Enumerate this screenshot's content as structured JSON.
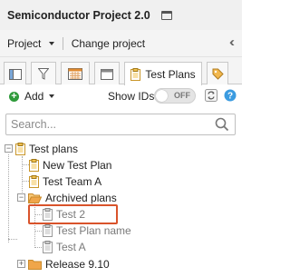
{
  "header": {
    "title": "Semiconductor Project 2.0",
    "window_icon": "window-icon"
  },
  "project_bar": {
    "project_label": "Project",
    "change_label": "Change project",
    "collapse_icon": "double-chevron-left-icon"
  },
  "tabs": [
    {
      "icon": "tree-view-icon",
      "label": ""
    },
    {
      "icon": "filter-icon",
      "label": ""
    },
    {
      "icon": "calendar-icon",
      "label": ""
    },
    {
      "icon": "window-icon",
      "label": ""
    },
    {
      "icon": "clipboard-icon",
      "label": "Test Plans",
      "active": true
    },
    {
      "icon": "tag-icon",
      "label": ""
    }
  ],
  "toolbar": {
    "add_label": "Add",
    "show_ids_label": "Show IDs",
    "toggle_state": "OFF",
    "refresh_icon": "refresh-icon",
    "help_icon": "help-icon"
  },
  "search": {
    "placeholder": "Search...",
    "value": ""
  },
  "tree": {
    "root": {
      "label": "Test plans",
      "icon": "clipboard-icon",
      "expanded": true
    },
    "items": [
      {
        "label": "New Test Plan",
        "icon": "clipboard-icon"
      },
      {
        "label": "Test Team A",
        "icon": "clipboard-icon"
      },
      {
        "label": "Archived plans",
        "icon": "folder-open-icon",
        "expanded": true,
        "children": [
          {
            "label": "Test 2",
            "icon": "clipboard-icon",
            "selected": true
          },
          {
            "label": "Test Plan name",
            "icon": "clipboard-icon"
          },
          {
            "label": "Test A",
            "icon": "clipboard-icon"
          }
        ]
      },
      {
        "label": "Release 9.10",
        "icon": "folder-icon",
        "expanded": false
      }
    ]
  },
  "colors": {
    "highlight_border": "#d9532b",
    "clipboard_yellow": "#f2c14e",
    "folder_orange": "#f0a64a",
    "add_green": "#2e9a3a",
    "help_blue": "#3b9be0"
  }
}
